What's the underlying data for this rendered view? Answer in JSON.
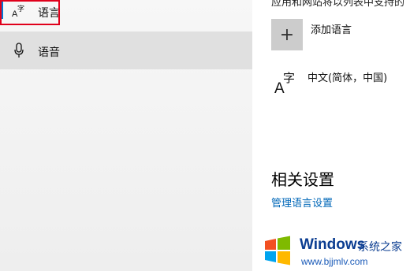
{
  "sidebar": {
    "items": [
      {
        "label": "语言",
        "icon": "language-icon",
        "selected": true
      },
      {
        "label": "语音",
        "icon": "microphone-icon"
      }
    ],
    "accent_color": "#0078d7",
    "highlight_color": "#e0001b"
  },
  "main": {
    "cut_text": "应用和网站将以列表中支持的",
    "add_language_label": "添加语言",
    "language_icon_text": "A字",
    "installed_language": "中文(简体，中国)",
    "related_settings_title": "相关设置",
    "manage_language_link": "管理语言设置",
    "link_color": "#0067b8"
  },
  "watermark": {
    "brand": "Windows",
    "brand_cn": "系统之家",
    "url": "www.bjjmlv.com"
  }
}
